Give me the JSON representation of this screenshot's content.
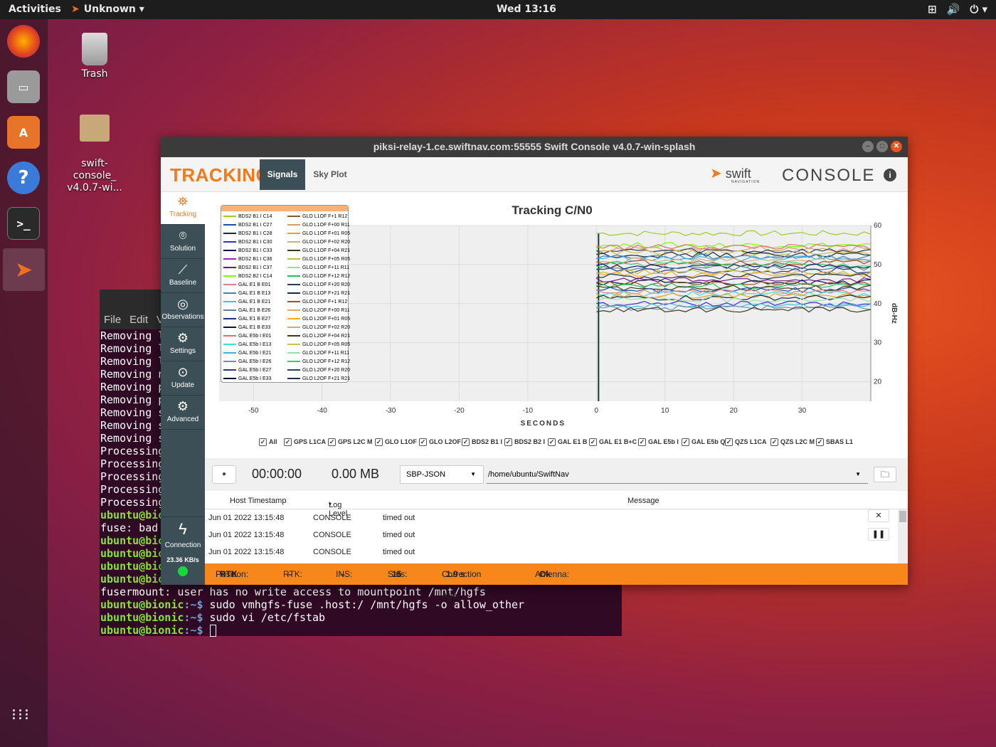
{
  "topbar": {
    "activities": "Activities",
    "app_name": "Unknown",
    "clock": "Wed 13:16"
  },
  "desktop": {
    "trash_label": "Trash",
    "file_label": "swift-\nconsole_\nv4.0.7-wi..."
  },
  "terminal": {
    "menu": [
      "File",
      "Edit",
      "V"
    ],
    "lines": [
      "Removing l",
      "Removing l",
      "Removing l",
      "Removing n",
      "Removing p",
      "Removing p",
      "Removing s",
      "Removing s",
      "Removing s",
      "Processing",
      "Processing",
      "Processing",
      "Processing",
      "Processing"
    ],
    "prompt_user": "ubuntu@bionic",
    "prompt_path": ":~$",
    "tail": [
      {
        "prompt": "ubuntu@bio",
        "text": ""
      },
      {
        "plain": "fuse: bad "
      },
      {
        "prompt": "ubuntu@bio",
        "text": ""
      },
      {
        "prompt": "ubuntu@bio",
        "text": ""
      },
      {
        "prompt": "ubuntu@bio",
        "text": ""
      },
      {
        "prompt": "ubuntu@bio",
        "text": ""
      },
      {
        "plain": "fusermount: user has no write access to mountpoint /mnt/hgfs"
      },
      {
        "prompt": "ubuntu@bionic",
        "text": " sudo vmhgfs-fuse .host:/ /mnt/hgfs -o allow_other"
      },
      {
        "prompt": "ubuntu@bionic",
        "text": " sudo vi /etc/fstab"
      },
      {
        "prompt": "ubuntu@bionic",
        "text": " "
      }
    ]
  },
  "swift": {
    "window_title": "piksi-relay-1.ce.swiftnav.com:55555 Swift Console v4.0.7-win-splash",
    "header_title": "TRACKING",
    "tabs": [
      "Signals",
      "Sky Plot"
    ],
    "logo_text": "swift",
    "logo_sub": "NAVIGATION",
    "console_label": "CONSOLE",
    "info_icon": "i",
    "nav": [
      "Tracking",
      "Solution",
      "Baseline",
      "Observations",
      "Settings",
      "Update",
      "Advanced"
    ],
    "connection_label": "Connection",
    "data_rate": "23.36 KB/s",
    "checkboxes": [
      "All",
      "GPS L1CA",
      "GPS L2C M",
      "GLO L1OF",
      "GLO L2OF",
      "BDS2 B1 I",
      "BDS2 B2 I",
      "GAL E1 B",
      "GAL E1 B+C",
      "GAL E5b I",
      "GAL E5b Q",
      "QZS L1CA",
      "QZS L2C M",
      "SBAS L1"
    ],
    "log": {
      "timer": "00:00:00",
      "size": "0.00 MB",
      "format": "SBP-JSON",
      "directory": "/home/ubuntu/SwiftNav",
      "columns": [
        "Host Timestamp",
        "Log Level",
        "Message"
      ],
      "rows": [
        {
          "ts": "Jun 01 2022 13:15:48",
          "level": "CONSOLE",
          "msg": "timed out"
        },
        {
          "ts": "Jun 01 2022 13:15:48",
          "level": "CONSOLE",
          "msg": "timed out"
        },
        {
          "ts": "Jun 01 2022 13:15:48",
          "level": "CONSOLE",
          "msg": "timed out"
        }
      ]
    },
    "status": {
      "position_label": "Position:",
      "position": "RTK",
      "rtk_label": "RTK:",
      "rtk": "–",
      "ins_label": "INS:",
      "ins": "–",
      "sats_label": "Sats:",
      "sats": "15",
      "corr_label": "Correction Age:",
      "corr": "1.9 s",
      "antenna_label": "Antenna:",
      "antenna": "Ok"
    }
  },
  "chart_data": {
    "type": "line",
    "title": "Tracking C/N0",
    "xlabel": "SECONDS",
    "ylabel": "dB-Hz",
    "xlim": [
      -55,
      40
    ],
    "ylim": [
      15,
      60
    ],
    "xticks": [
      -50,
      -40,
      -30,
      -20,
      -10,
      0,
      10,
      20,
      30
    ],
    "yticks": [
      20,
      30,
      40,
      50,
      60
    ],
    "grid": true,
    "legend_position": "top-left",
    "legend": [
      {
        "name": "BDS2 B1 I C14",
        "color": "#9acd32"
      },
      {
        "name": "BDS2 B1 I C27",
        "color": "#1f4fa8"
      },
      {
        "name": "BDS2 B1 I C28",
        "color": "#1a2a3a"
      },
      {
        "name": "BDS2 B1 I C30",
        "color": "#3030d0"
      },
      {
        "name": "BDS2 B1 I C33",
        "color": "#101060"
      },
      {
        "name": "BDS2 B1 I C36",
        "color": "#a020c0"
      },
      {
        "name": "BDS2 B1 I C37",
        "color": "#6a1a8a"
      },
      {
        "name": "BDS2 B2 I C14",
        "color": "#7cfc00"
      },
      {
        "name": "GAL E1 B E01",
        "color": "#e08080"
      },
      {
        "name": "GAL E1 B E13",
        "color": "#4682b4"
      },
      {
        "name": "GAL E1 B E21",
        "color": "#40c0e0"
      },
      {
        "name": "GAL E1 B E26",
        "color": "#6080a0"
      },
      {
        "name": "GAL E1 B E27",
        "color": "#203080"
      },
      {
        "name": "GAL E1 B E33",
        "color": "#101040"
      },
      {
        "name": "GAL E5b I E01",
        "color": "#e07070"
      },
      {
        "name": "GAL E5b I E13",
        "color": "#40e0d0"
      },
      {
        "name": "GAL E5b I E21",
        "color": "#40b0e0"
      },
      {
        "name": "GAL E5b I E26",
        "color": "#7090b0"
      },
      {
        "name": "GAL E5b I E27",
        "color": "#2a3a7a"
      },
      {
        "name": "GAL E5b I E33",
        "color": "#0a0a30"
      },
      {
        "name": "GLO L1OF F+1 R12",
        "color": "#8b5a2b"
      },
      {
        "name": "GLO L1OF F+00 R11",
        "color": "#d2a070"
      },
      {
        "name": "GLO L1OF F+01 R05",
        "color": "#f0a020"
      },
      {
        "name": "GLO L1OF F+02 R20",
        "color": "#c8b080"
      },
      {
        "name": "GLO L1OF F+04 R21",
        "color": "#3a3a1a"
      },
      {
        "name": "GLO L1OF F+05 R05",
        "color": "#c0c040"
      },
      {
        "name": "GLO L1OF F+11 R11",
        "color": "#90e0a0"
      },
      {
        "name": "GLO L1OF F+12 R12",
        "color": "#20c060"
      },
      {
        "name": "GLO L1OF F+20 R20",
        "color": "#2a3a5a"
      },
      {
        "name": "GLO L1OF F+21 R21",
        "color": "#1a2a4a"
      },
      {
        "name": "GLO L2OF F+1 R12",
        "color": "#a0522d"
      },
      {
        "name": "GLO L2OF F+00 R11",
        "color": "#d8a878"
      },
      {
        "name": "GLO L2OF F+01 R05",
        "color": "#f0a830"
      },
      {
        "name": "GLO L2OF F+02 R20",
        "color": "#c0b088"
      },
      {
        "name": "GLO L2OF F+04 R21",
        "color": "#403a10"
      },
      {
        "name": "GLO L2OF F+05 R05",
        "color": "#c8c050"
      },
      {
        "name": "GLO L2OF F+11 R11",
        "color": "#98e0a8"
      },
      {
        "name": "GLO L2OF F+12 R12",
        "color": "#30d070"
      },
      {
        "name": "GLO L2OF F+20 R20",
        "color": "#304060"
      },
      {
        "name": "GLO L2OF F+21 R21",
        "color": "#203050"
      }
    ],
    "series_levels": [
      58,
      55,
      54.5,
      54,
      53.5,
      53,
      52.5,
      52,
      51.5,
      51,
      50.5,
      50,
      49.5,
      49,
      48.5,
      48,
      47.5,
      47,
      46,
      45.5,
      45,
      44.5,
      44,
      43.5,
      43,
      42.5,
      42,
      41.5,
      41,
      40,
      39.5,
      39,
      38.5
    ]
  }
}
